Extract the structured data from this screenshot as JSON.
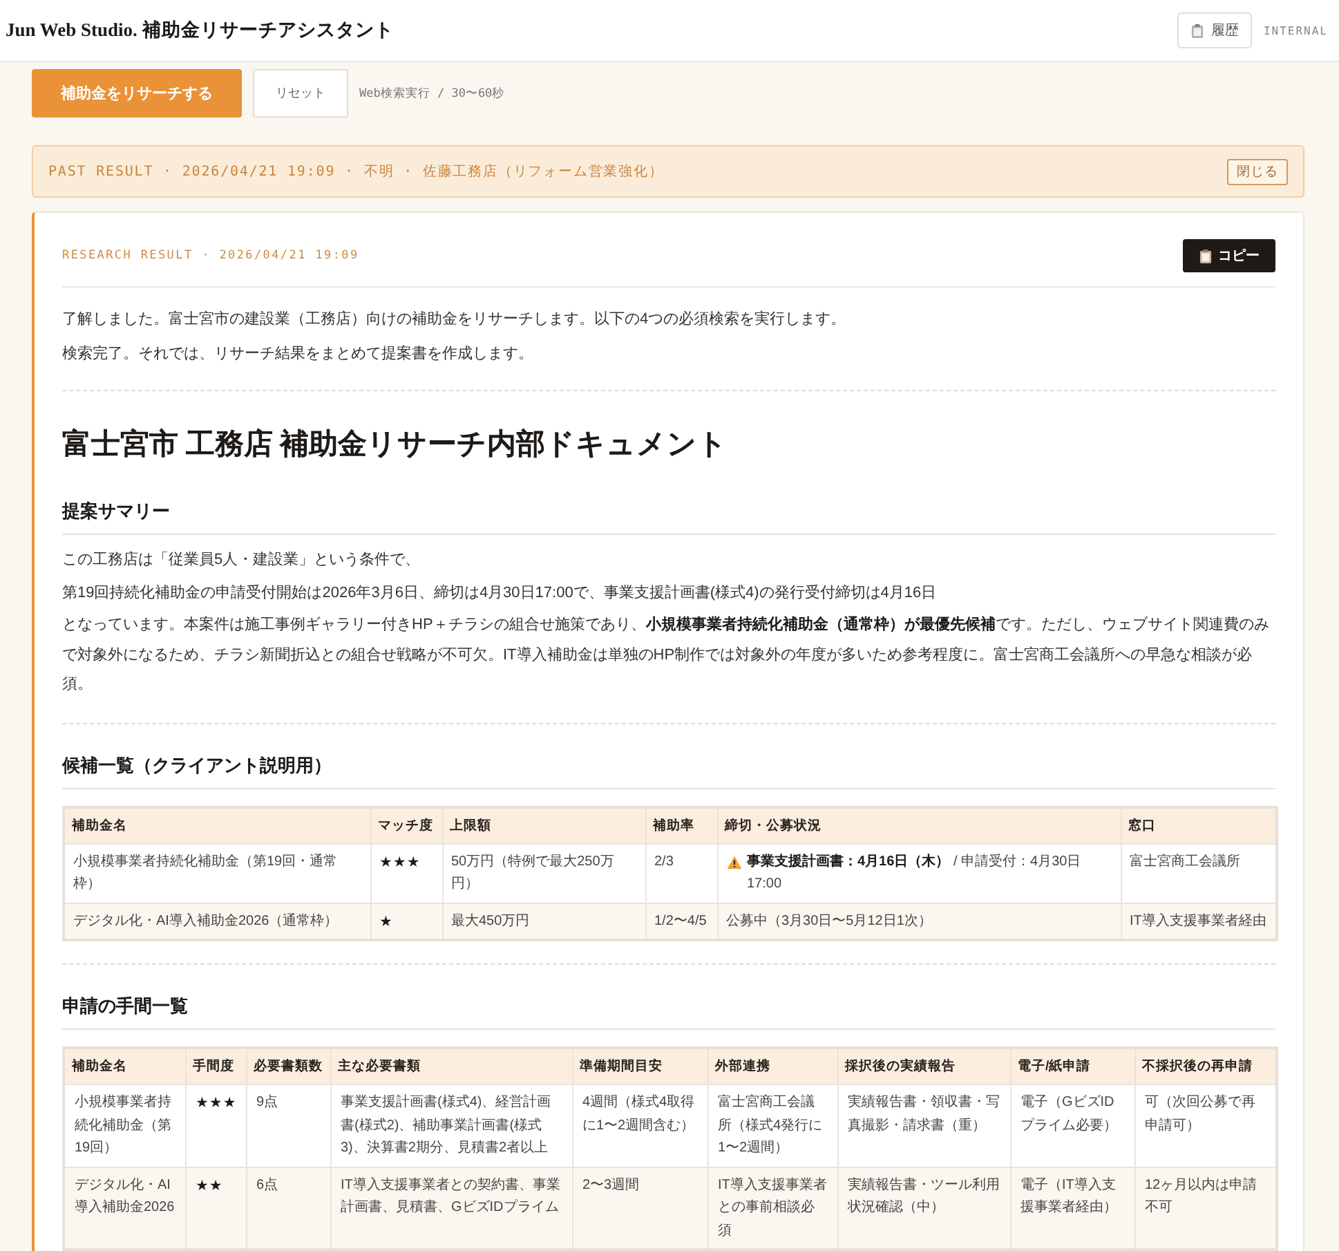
{
  "header": {
    "title": "Jun Web Studio. 補助金リサーチアシスタント",
    "history_button": "履歴",
    "badge": "INTERNAL"
  },
  "actions": {
    "research_button": "補助金をリサーチする",
    "reset_button": "リセット",
    "hint": "Web検索実行 / 30〜60秒"
  },
  "past_result": {
    "text": "PAST RESULT · 2026/04/21 19:09 · 不明 · 佐藤工務店（リフォーム営業強化）",
    "close_button": "閉じる"
  },
  "result": {
    "label": "RESEARCH RESULT · 2026/04/21 19:09",
    "copy_button": "コピー",
    "intro": [
      "了解しました。富士宮市の建設業（工務店）向けの補助金をリサーチします。以下の4つの必須検索を実行します。",
      "検索完了。それでは、リサーチ結果をまとめて提案書を作成します。"
    ]
  },
  "document": {
    "title": "富士宮市 工務店 補助金リサーチ内部ドキュメント",
    "sections": [
      {
        "kind": "summary",
        "heading": "提案サマリー",
        "lines": [
          "この工務店は「従業員5人・建設業」という条件で、",
          "第19回持続化補助金の申請受付開始は2026年3月6日、締切は4月30日17:00で、事業支援計画書(様式4)の発行受付締切は4月16日",
          "となっています。本案件は施工事例ギャラリー付きHP＋チラシの組合せ施策であり、**小規模事業者持続化補助金（通常枠）が最優先候補**です。ただし、ウェブサイト関連費のみで対象外になるため、チラシ新聞折込との組合せ戦略が不可欠。IT導入補助金は単独のHP制作では対象外の年度が多いため参考程度に。富士宮商工会議所への早急な相談が必須。"
        ]
      },
      {
        "kind": "table",
        "heading": "候補一覧（クライアント説明用）",
        "columns": [
          "補助金名",
          "マッチ度",
          "上限額",
          "補助率",
          "締切・公募状況",
          "窓口"
        ],
        "rows": [
          {
            "cells": [
              {
                "kind": "text",
                "text": "小規模事業者持続化補助金（第19回・通常枠）"
              },
              {
                "kind": "rating",
                "text": "★★★"
              },
              {
                "kind": "text",
                "text": "50万円（特例で最大250万円）"
              },
              {
                "kind": "text",
                "text": "2/3"
              },
              {
                "kind": "status",
                "text": "**事業支援計画書：4月16日（木）** / 申請受付：4月30日 17:00",
                "warning": true
              },
              {
                "kind": "text",
                "text": "富士宮商工会議所"
              }
            ]
          },
          {
            "cells": [
              {
                "kind": "text",
                "text": "デジタル化・AI導入補助金2026（通常枠）"
              },
              {
                "kind": "rating",
                "text": "★"
              },
              {
                "kind": "text",
                "text": "最大450万円"
              },
              {
                "kind": "text",
                "text": "1/2〜4/5"
              },
              {
                "kind": "status",
                "text": "公募中（3月30日〜5月12日1次）",
                "warning": false
              },
              {
                "kind": "text",
                "text": "IT導入支援事業者経由"
              }
            ]
          }
        ]
      },
      {
        "kind": "table",
        "heading": "申請の手間一覧",
        "columns": [
          "補助金名",
          "手間度",
          "必要書類数",
          "主な必要書類",
          "準備期間目安",
          "外部連携",
          "採択後の実績報告",
          "電子/紙申請",
          "不採択後の再申請"
        ],
        "rows": [
          {
            "cells": [
              {
                "kind": "text",
                "text": "小規模事業者持続化補助金（第19回）"
              },
              {
                "kind": "rating",
                "text": "★★★"
              },
              {
                "kind": "text",
                "text": "9点"
              },
              {
                "kind": "text",
                "text": "事業支援計画書(様式4)、経営計画書(様式2)、補助事業計画書(様式3)、決算書2期分、見積書2者以上"
              },
              {
                "kind": "text",
                "text": "4週間（様式4取得に1〜2週間含む）"
              },
              {
                "kind": "text",
                "text": "富士宮商工会議所（様式4発行に1〜2週間）"
              },
              {
                "kind": "text",
                "text": "実績報告書・領収書・写真撮影・請求書（重）"
              },
              {
                "kind": "text",
                "text": "電子（GビズIDプライム必要）"
              },
              {
                "kind": "text",
                "text": "可（次回公募で再申請可）"
              }
            ]
          },
          {
            "cells": [
              {
                "kind": "text",
                "text": "デジタル化・AI導入補助金2026"
              },
              {
                "kind": "rating",
                "text": "★★"
              },
              {
                "kind": "text",
                "text": "6点"
              },
              {
                "kind": "text",
                "text": "IT導入支援事業者との契約書、事業計画書、見積書、GビズIDプライム"
              },
              {
                "kind": "text",
                "text": "2〜3週間"
              },
              {
                "kind": "text",
                "text": "IT導入支援事業者との事前相談必須"
              },
              {
                "kind": "text",
                "text": "実績報告書・ツール利用状況確認（中）"
              },
              {
                "kind": "text",
                "text": "電子（IT導入支援事業者経由）"
              },
              {
                "kind": "text",
                "text": "12ヶ月以内は申請不可"
              }
            ]
          }
        ]
      }
    ]
  }
}
